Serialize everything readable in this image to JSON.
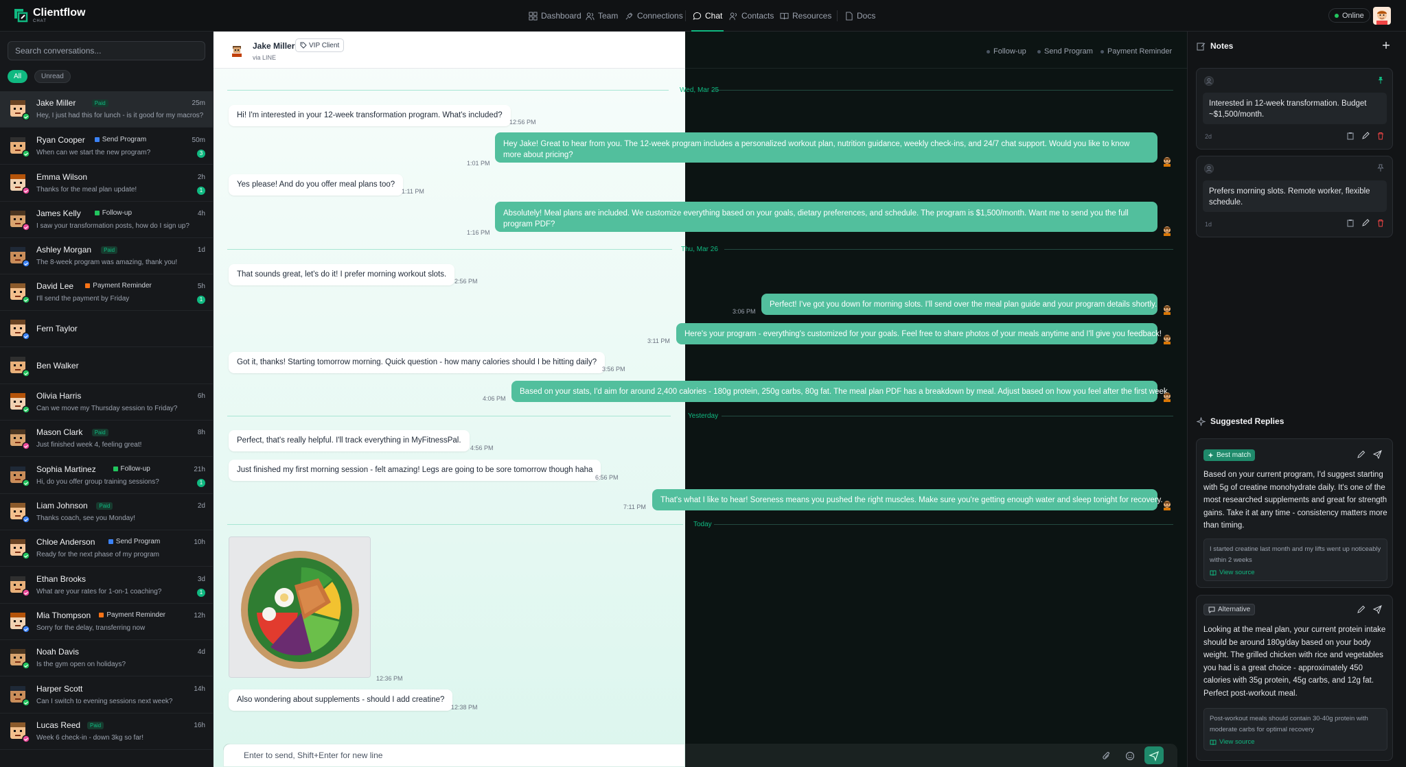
{
  "app": {
    "name": "Clientflow",
    "subname": "CHAT",
    "status": "Online"
  },
  "nav": {
    "dashboard": "Dashboard",
    "team": "Team",
    "connections": "Connections",
    "chat": "Chat",
    "contacts": "Contacts",
    "resources": "Resources",
    "docs": "Docs"
  },
  "sidebar": {
    "search_placeholder": "Search conversations...",
    "filter_all": "All",
    "filter_unread": "Unread",
    "conversations": [
      {
        "name": "Jake Miller",
        "tag": "Paid",
        "preview": "Hey, I just had this for lunch - is it good for my macros?",
        "time": "25m",
        "unread": ""
      },
      {
        "name": "Ryan Cooper",
        "tag": "Send Program",
        "preview": "When can we start the new program?",
        "time": "50m",
        "unread": "3"
      },
      {
        "name": "Emma Wilson",
        "tag": "",
        "preview": "Thanks for the meal plan update!",
        "time": "2h",
        "unread": "1"
      },
      {
        "name": "James Kelly",
        "tag": "Follow-up",
        "preview": "I saw your transformation posts, how do I sign up?",
        "time": "4h",
        "unread": ""
      },
      {
        "name": "Ashley Morgan",
        "tag": "Paid",
        "preview": "The 8-week program was amazing, thank you!",
        "time": "1d",
        "unread": ""
      },
      {
        "name": "David Lee",
        "tag": "Payment Reminder",
        "preview": "I'll send the payment by Friday",
        "time": "5h",
        "unread": "1"
      },
      {
        "name": "Fern Taylor",
        "tag": "",
        "preview": "",
        "time": "",
        "unread": ""
      },
      {
        "name": "Ben Walker",
        "tag": "",
        "preview": "",
        "time": "",
        "unread": ""
      },
      {
        "name": "Olivia Harris",
        "tag": "",
        "preview": "Can we move my Thursday session to Friday?",
        "time": "6h",
        "unread": ""
      },
      {
        "name": "Mason Clark",
        "tag": "Paid",
        "preview": "Just finished week 4, feeling great!",
        "time": "8h",
        "unread": ""
      },
      {
        "name": "Sophia Martinez",
        "tag": "Follow-up",
        "preview": "Hi, do you offer group training sessions?",
        "time": "21h",
        "unread": "1"
      },
      {
        "name": "Liam Johnson",
        "tag": "Paid",
        "preview": "Thanks coach, see you Monday!",
        "time": "2d",
        "unread": ""
      },
      {
        "name": "Chloe Anderson",
        "tag": "Send Program",
        "preview": "Ready for the next phase of my program",
        "time": "10h",
        "unread": ""
      },
      {
        "name": "Ethan Brooks",
        "tag": "",
        "preview": "What are your rates for 1-on-1 coaching?",
        "time": "3d",
        "unread": "1"
      },
      {
        "name": "Mia Thompson",
        "tag": "Payment Reminder",
        "preview": "Sorry for the delay, transferring now",
        "time": "12h",
        "unread": ""
      },
      {
        "name": "Noah Davis",
        "tag": "",
        "preview": "Is the gym open on holidays?",
        "time": "4d",
        "unread": ""
      },
      {
        "name": "Harper Scott",
        "tag": "",
        "preview": "Can I switch to evening sessions next week?",
        "time": "14h",
        "unread": ""
      },
      {
        "name": "Lucas Reed",
        "tag": "Paid",
        "preview": "Week 6 check-in - down 3kg so far!",
        "time": "16h",
        "unread": ""
      }
    ]
  },
  "chat": {
    "contact_name": "Jake Miller",
    "contact_tag": "VIP Client",
    "contact_channel": "via LINE",
    "quick_actions": [
      "Follow-up",
      "Send Program",
      "Payment Reminder"
    ],
    "dates": [
      "Wed, Mar 25",
      "Thu, Mar 26",
      "Yesterday",
      "Today"
    ],
    "messages": [
      {
        "text": "Hi! I'm interested in your 12-week transformation program. What's included?",
        "time": "12:56 PM"
      },
      {
        "text": "Hey Jake! Great to hear from you. The 12-week program includes a personalized workout plan, nutrition guidance, weekly check-ins, and 24/7 chat support. Would you like to know more about pricing?",
        "time": "1:01 PM"
      },
      {
        "text": "Yes please! And do you offer meal plans too?",
        "time": "1:11 PM"
      },
      {
        "text": "Absolutely! Meal plans are included. We customize everything based on your goals, dietary preferences, and schedule. The program is $1,500/month. Want me to send you the full program PDF?",
        "time": "1:16 PM"
      },
      {
        "text": "That sounds great, let's do it! I prefer morning workout slots.",
        "time": "2:56 PM"
      },
      {
        "text": "Perfect! I've got you down for morning slots. I'll send over the meal plan guide and your program details shortly.",
        "time": "3:06 PM"
      },
      {
        "text": "Here's your program - everything's customized for your goals. Feel free to share photos of your meals anytime and I'll give you feedback!",
        "time": "3:11 PM"
      },
      {
        "text": "Got it, thanks! Starting tomorrow morning. Quick question - how many calories should I be hitting daily?",
        "time": "3:56 PM"
      },
      {
        "text": "Based on your stats, I'd aim for around 2,400 calories - 180g protein, 250g carbs, 80g fat. The meal plan PDF has a breakdown by meal. Adjust based on how you feel after the first week.",
        "time": "4:06 PM"
      },
      {
        "text": "Perfect, that's really helpful. I'll track everything in MyFitnessPal.",
        "time": "4:56 PM"
      },
      {
        "text": "Just finished my first morning session - felt amazing! Legs are going to be sore tomorrow though haha",
        "time": "6:56 PM"
      },
      {
        "text": "That's what I like to hear! Soreness means you pushed the right muscles. Make sure you're getting enough water and sleep tonight for recovery.",
        "time": "7:11 PM"
      },
      {
        "text": "",
        "time": "12:36 PM"
      },
      {
        "text": "Also wondering about supplements - should I add creatine?",
        "time": "12:38 PM"
      }
    ],
    "input_placeholder": "Enter to send, Shift+Enter for new line"
  },
  "notes": {
    "title": "Notes",
    "items": [
      {
        "text": "Interested in 12-week transformation. Budget ~$1,500/month.",
        "time": "2d"
      },
      {
        "text": "Prefers morning slots. Remote worker, flexible schedule.",
        "time": "1d"
      }
    ]
  },
  "suggestions": {
    "title": "Suggested Replies",
    "items": [
      {
        "label": "Best match",
        "text": "Based on your current program, I'd suggest starting with 5g of creatine monohydrate daily. It's one of the most researched supplements and great for strength gains. Take it at any time - consistency matters more than timing.",
        "source": "I started creatine last month and my lifts went up noticeably within 2 weeks",
        "view": "View source"
      },
      {
        "label": "Alternative",
        "text": "Looking at the meal plan, your current protein intake should be around 180g/day based on your body weight. The grilled chicken with rice and vegetables you had is a great choice - approximately 450 calories with 35g protein, 45g carbs, and 12g fat. Perfect post-workout meal.",
        "source": "Post-workout meals should contain 30-40g protein with moderate carbs for optimal recovery",
        "view": "View source"
      }
    ]
  },
  "colors": {
    "accent": "#10b981",
    "bubble_out": "#52bf9d",
    "tag_send_program": "#3b82f6",
    "tag_follow_up": "#22c55e",
    "tag_payment": "#f97316"
  }
}
